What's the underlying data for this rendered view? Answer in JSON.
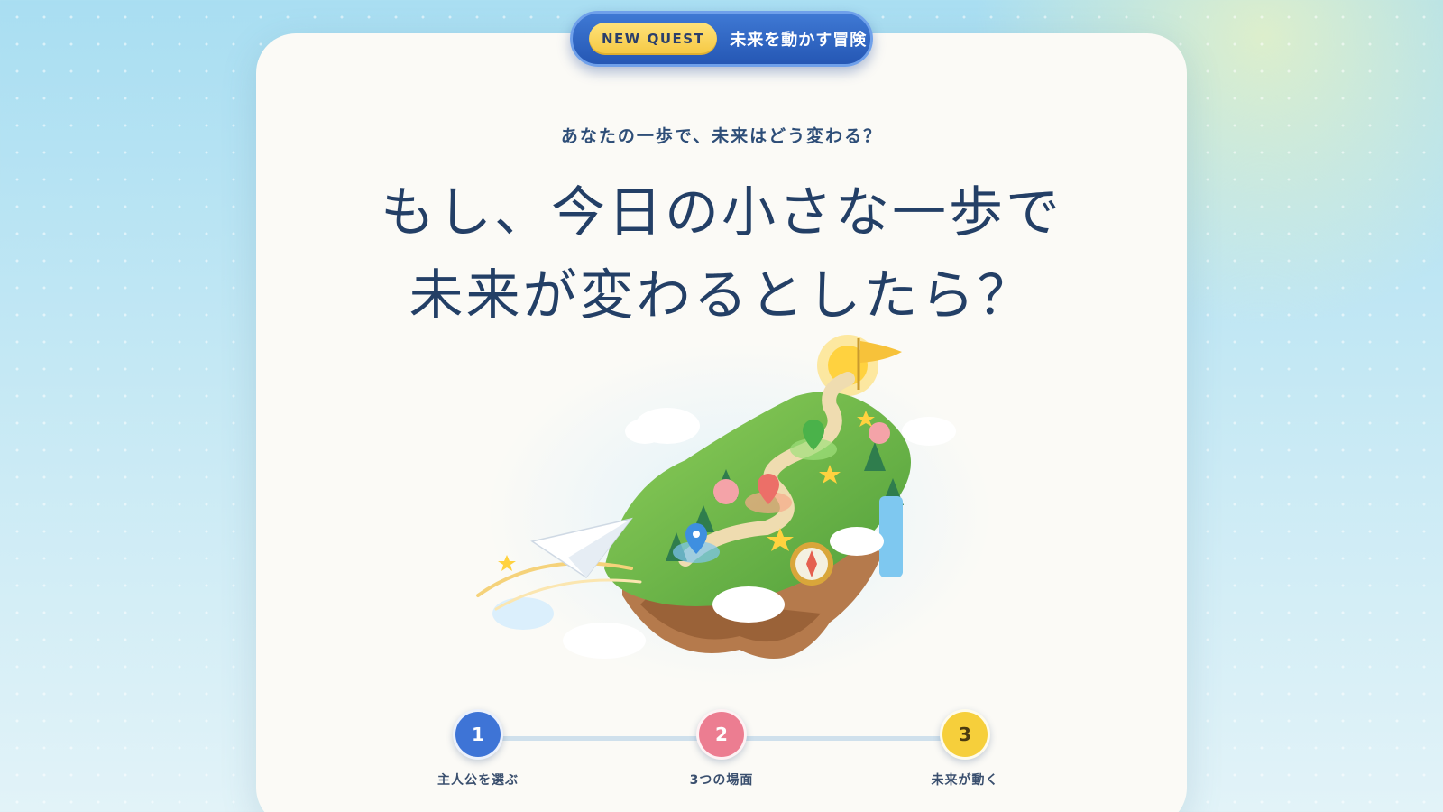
{
  "header": {
    "badge_label": "NEW QUEST",
    "title": "未来を動かす冒険"
  },
  "hero": {
    "eyebrow": "あなたの一歩で、未来はどう変わる？",
    "headline_line1": "もし、今日の小さな一歩で",
    "headline_line2": "未来が変わるとしたら？"
  },
  "steps": [
    {
      "number": "1",
      "label": "主人公を選ぶ",
      "color": "#3e74d6"
    },
    {
      "number": "2",
      "label": "3つの場面",
      "color": "#ec7d91"
    },
    {
      "number": "3",
      "label": "未来が動く",
      "color": "#f6cf3b"
    }
  ],
  "colors": {
    "accent_blue": "#2557b4",
    "badge_gold": "#f5c842",
    "text_navy": "#233f66"
  },
  "icons": [
    "map-pin-icon",
    "heart-pin-icon",
    "sprout-pin-icon",
    "star-icon",
    "compass-icon",
    "paper-plane-icon",
    "flag-icon",
    "sun-icon"
  ]
}
